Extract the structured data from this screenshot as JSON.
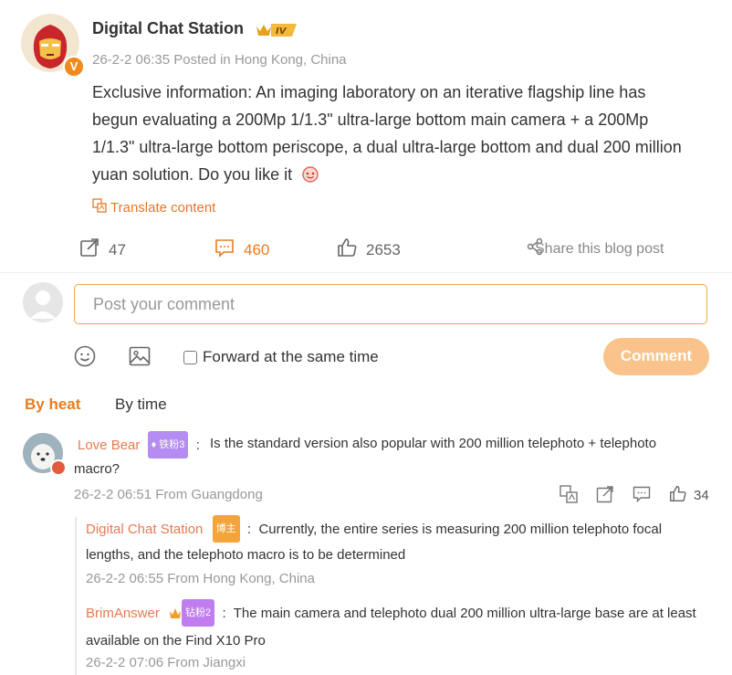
{
  "post": {
    "author": "Digital Chat Station",
    "level_badge": "IV",
    "verified_mark": "V",
    "meta": "26-2-2 06:35  Posted in Hong Kong, China",
    "text": "Exclusive information: An imaging laboratory on an iterative flagship line has begun evaluating a 200Mp 1/1.3\" ultra-large bottom main camera + a 200Mp 1/1.3\" ultra-large bottom periscope, a dual ultra-large bottom and dual 200 million yuan solution. Do you like it",
    "translate_label": "Translate content",
    "stats": {
      "reposts": "47",
      "comments": "460",
      "likes": "2653"
    },
    "share_label": "Share this blog post"
  },
  "compose": {
    "placeholder": "Post your comment",
    "forward_label": "Forward at the same time",
    "submit_label": "Comment"
  },
  "sort": {
    "by_heat": "By heat",
    "by_time": "By time"
  },
  "comments": [
    {
      "name": "Love Bear",
      "badge": "铁粉3",
      "text": "Is the standard version also popular with 200 million telephoto + telephoto macro?",
      "meta": "26-2-2 06:51 From Guangdong",
      "likes": "34",
      "replies": [
        {
          "name": "Digital Chat Station",
          "badge": "博主",
          "text": "Currently, the entire series is measuring 200 million telephoto focal lengths, and the telephoto macro is to be determined",
          "meta": "26-2-2 06:55 From Hong Kong, China"
        },
        {
          "name": "BrimAnswer",
          "badge": "钻粉2",
          "text": "The main camera and telephoto dual 200 million ultra-large base are at least available on the Find X10 Pro",
          "meta": "26-2-2 07:06 From Jiangxi"
        }
      ]
    }
  ],
  "colors": {
    "accent": "#e87d1f",
    "name": "#e57a52",
    "button": "#f9c38b",
    "muted": "#999999"
  }
}
